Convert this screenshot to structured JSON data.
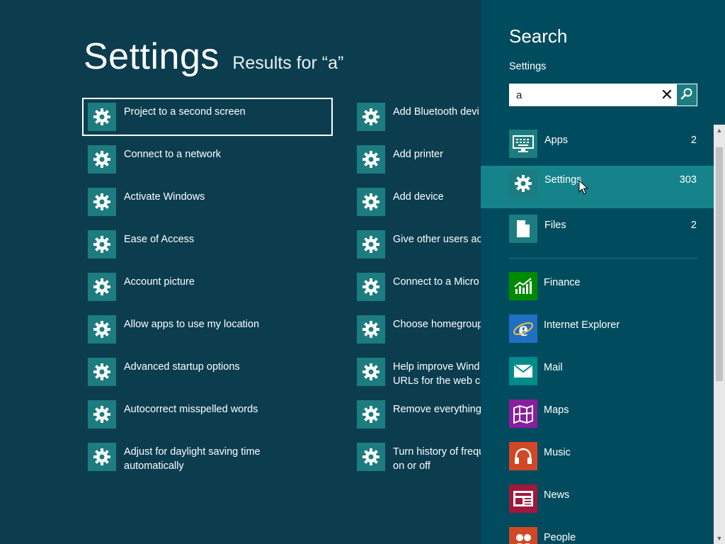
{
  "header": {
    "title": "Settings",
    "subtitle": "Results for “a”"
  },
  "results": {
    "column1": [
      {
        "label": "Project to a second screen",
        "selected": true
      },
      {
        "label": "Connect to a network"
      },
      {
        "label": "Activate Windows"
      },
      {
        "label": "Ease of Access"
      },
      {
        "label": "Account picture"
      },
      {
        "label": "Allow apps to use my location"
      },
      {
        "label": "Advanced startup options"
      },
      {
        "label": "Autocorrect misspelled words"
      },
      {
        "label": "Adjust for daylight saving time\nautomatically"
      }
    ],
    "column2": [
      {
        "label": "Add Bluetooth devi"
      },
      {
        "label": "Add printer"
      },
      {
        "label": "Add device"
      },
      {
        "label": "Give other users acc"
      },
      {
        "label": "Connect to a Micro"
      },
      {
        "label": "Choose homegroup"
      },
      {
        "label": "Help improve Wind\nURLs for the web co"
      },
      {
        "label": "Remove everything"
      },
      {
        "label": "Turn history of frequ\non or off"
      }
    ],
    "icon": "gear-icon"
  },
  "search": {
    "title": "Search",
    "scope": "Settings",
    "query": "a",
    "clear_glyph": "✕",
    "categories": [
      {
        "name": "Apps",
        "count": "2",
        "icon": "keyboard-icon"
      },
      {
        "name": "Settings",
        "count": "303",
        "icon": "gear-icon",
        "active": true
      },
      {
        "name": "Files",
        "count": "2",
        "icon": "file-icon"
      }
    ],
    "apps": [
      {
        "name": "Finance",
        "icon": "finance-icon",
        "color": "#008a00"
      },
      {
        "name": "Internet Explorer",
        "icon": "internet-explorer-icon",
        "color": "#1f6fc5"
      },
      {
        "name": "Mail",
        "icon": "mail-icon",
        "color": "#008a8a"
      },
      {
        "name": "Maps",
        "icon": "maps-icon",
        "color": "#8a1e9e"
      },
      {
        "name": "Music",
        "icon": "music-icon",
        "color": "#d24726"
      },
      {
        "name": "News",
        "icon": "news-icon",
        "color": "#a4163a"
      },
      {
        "name": "People",
        "icon": "people-icon",
        "color": "#d24726"
      }
    ]
  },
  "colors": {
    "background": "#0b3d4f",
    "charm": "#004c5e",
    "tile": "#1d7c80",
    "active_category": "#16838a"
  }
}
